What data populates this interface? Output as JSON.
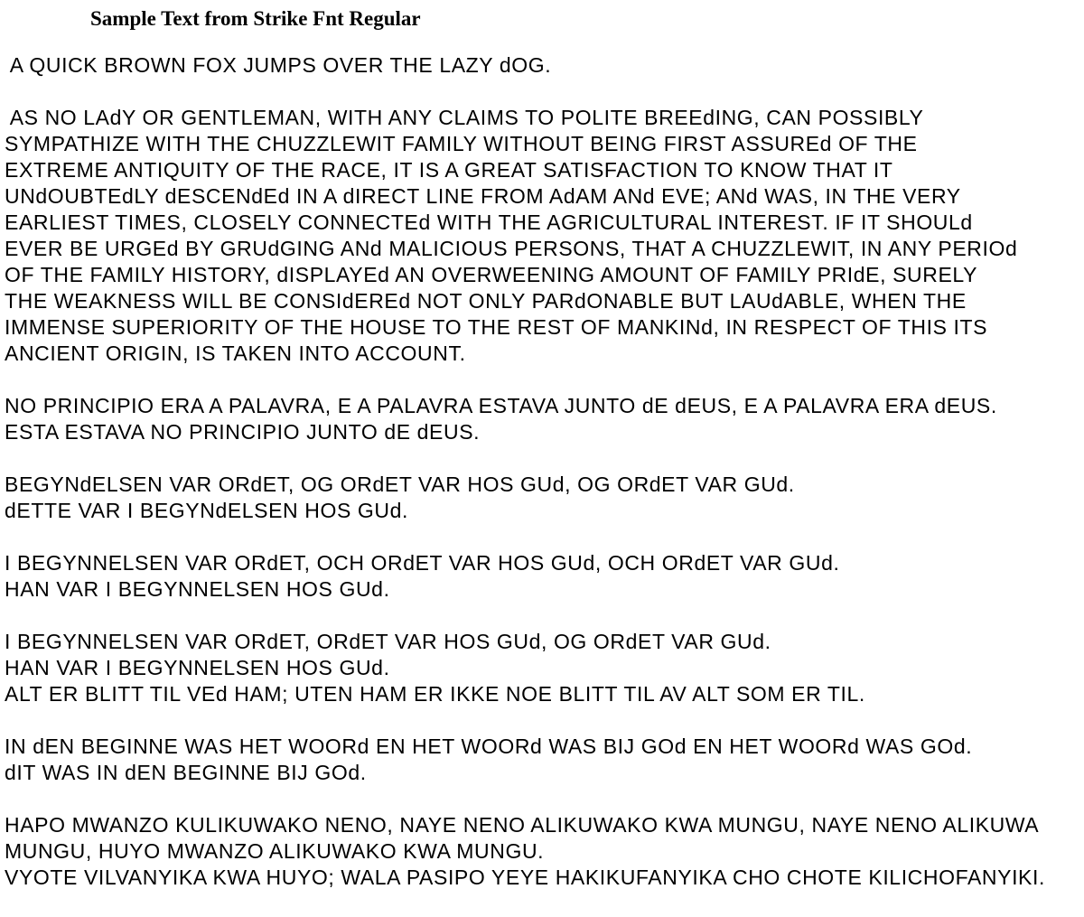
{
  "title": "Sample Text from Strike Fnt Regular",
  "paragraphs": [
    [
      " A QUICK BROWN FOX JUMPS OVER THE LAZY dOG."
    ],
    [
      " AS NO LAdY OR GENTLEMAN, WITH ANY CLAIMS TO POLITE BREEdING, CAN POSSIBLY",
      "SYMPATHIZE WITH THE CHUZZLEWIT FAMILY WITHOUT BEING FIRST ASSUREd OF THE",
      "EXTREME ANTIQUITY OF THE RACE, IT IS A GREAT SATISFACTION TO KNOW THAT IT",
      "UNdOUBTEdLY dESCENdEd IN A dIRECT LINE FROM AdAM ANd EVE; ANd WAS, IN THE VERY",
      "EARLIEST TIMES, CLOSELY CONNECTEd WITH THE AGRICULTURAL INTEREST. IF IT SHOULd",
      "EVER BE URGEd BY GRUdGING ANd MALICIOUS PERSONS, THAT A CHUZZLEWIT, IN ANY PERIOd",
      "OF THE FAMILY HISTORY, dISPLAYEd AN OVERWEENING AMOUNT OF FAMILY PRIdE, SURELY",
      "THE WEAKNESS WILL BE CONSIdEREd NOT ONLY PARdONABLE BUT LAUdABLE, WHEN THE",
      "IMMENSE SUPERIORITY OF THE HOUSE TO THE REST OF MANKINd, IN RESPECT OF THIS ITS",
      "ANCIENT ORIGIN, IS TAKEN INTO ACCOUNT."
    ],
    [
      "NO PRINCIPIO ERA A PALAVRA, E A PALAVRA ESTAVA JUNTO dE dEUS, E A PALAVRA ERA dEUS.",
      "ESTA ESTAVA NO PRINCIPIO JUNTO dE dEUS."
    ],
    [
      "BEGYNdELSEN VAR ORdET, OG ORdET VAR HOS GUd, OG ORdET VAR GUd.",
      "dETTE VAR I BEGYNdELSEN HOS GUd."
    ],
    [
      "I BEGYNNELSEN VAR ORdET, OCH ORdET VAR HOS GUd, OCH ORdET VAR GUd.",
      "HAN VAR I BEGYNNELSEN HOS GUd."
    ],
    [
      "I BEGYNNELSEN VAR ORdET, ORdET VAR HOS GUd, OG ORdET VAR GUd.",
      "HAN VAR I BEGYNNELSEN HOS GUd.",
      "ALT ER BLITT TIL VEd HAM; UTEN HAM ER IKKE NOE BLITT TIL AV ALT SOM ER TIL."
    ],
    [
      "IN dEN BEGINNE WAS HET WOORd EN HET WOORd WAS BIJ GOd EN HET WOORd WAS GOd.",
      "dIT WAS IN dEN BEGINNE BIJ GOd."
    ],
    [
      "HAPO MWANZO KULIKUWAKO NENO, NAYE NENO ALIKUWAKO KWA MUNGU, NAYE NENO ALIKUWA",
      "MUNGU, HUYO MWANZO ALIKUWAKO KWA MUNGU.",
      "VYOTE VILVANYIKA KWA HUYO; WALA PASIPO YEYE HAKIKUFANYIKA CHO CHOTE KILICHOFANYIKI."
    ]
  ]
}
